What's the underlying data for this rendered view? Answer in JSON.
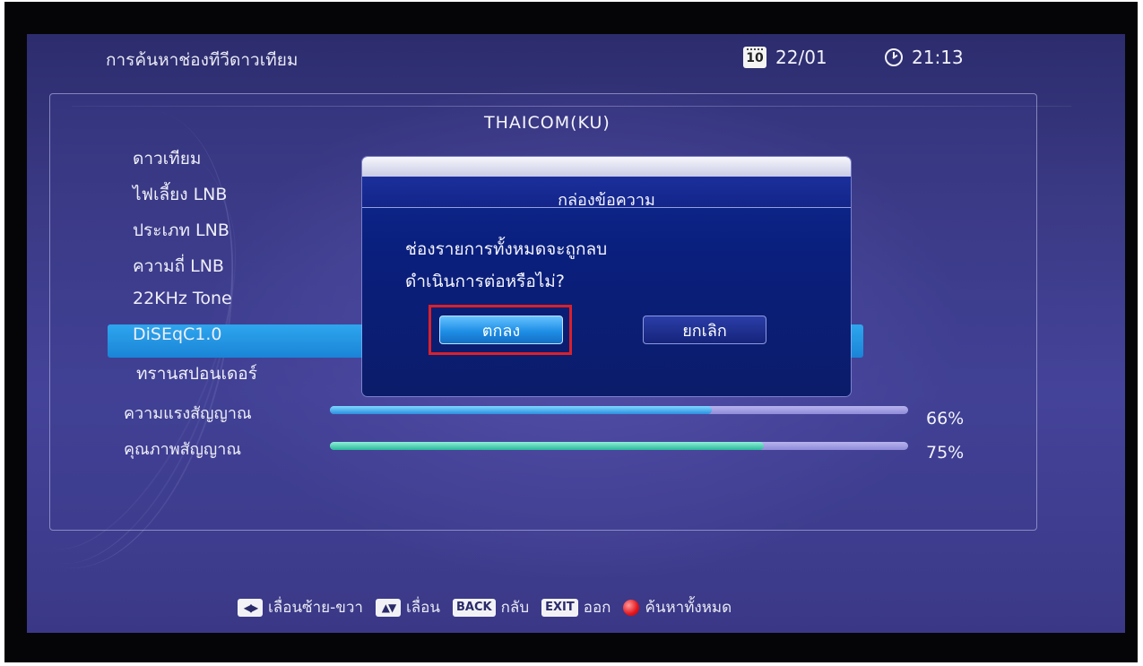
{
  "header": {
    "title": "การค้นหาช่องทีวีดาวเทียม",
    "date_icon_text": "10",
    "date": "22/01",
    "time": "21:13"
  },
  "settings": {
    "labels": [
      "ดาวเทียม",
      "ไฟเลี้ยง LNB",
      "ประเภท LNB",
      "ความถี่ LNB",
      "22KHz Tone",
      "DiSEqC1.0",
      "ทรานสปอนเดอร์"
    ],
    "satellite_value": "THAICOM(KU)"
  },
  "signal": {
    "strength_label": "ความแรงสัญญาณ",
    "strength_value": 66,
    "strength_pct": "66%",
    "quality_label": "คุณภาพสัญญาณ",
    "quality_value": 75,
    "quality_pct": "75%"
  },
  "dialog": {
    "title": "กล่องข้อความ",
    "message_line1": "ช่องรายการทั้งหมดจะถูกลบ",
    "message_line2": "ดำเนินการต่อหรือไม่?",
    "ok_label": "ตกลง",
    "cancel_label": "ยกเลิก"
  },
  "footer": {
    "lr_text": "เลื่อนซ้าย-ขวา",
    "ud_text": "เลื่อน",
    "back_key": "BACK",
    "back_text": "กลับ",
    "exit_key": "EXIT",
    "exit_text": "ออก",
    "search_all_text": "ค้นหาทั้งหมด"
  },
  "colors": {
    "highlight": "#1a84d6",
    "strength_fill": "#2b8fe0",
    "quality_fill": "#2ab89a",
    "annotation_box": "#d9212b"
  }
}
